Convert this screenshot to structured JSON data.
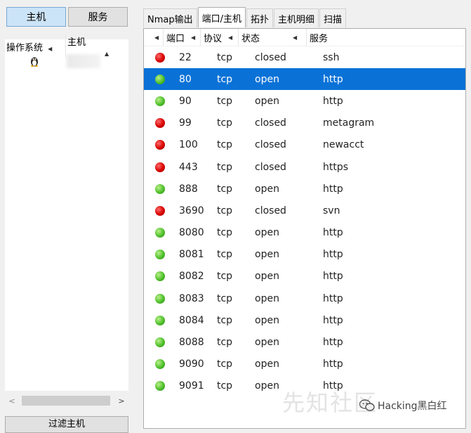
{
  "left_panel": {
    "hosts_button": "主机",
    "services_button": "服务",
    "columns": {
      "os": "操作系统",
      "host": "主机"
    },
    "filter_button": "过滤主机"
  },
  "tabs": [
    "Nmap输出",
    "端口/主机",
    "拓扑",
    "主机明细",
    "扫描"
  ],
  "active_tab": "端口/主机",
  "ports_table": {
    "columns": {
      "port": "端口",
      "protocol": "协议",
      "state": "状态",
      "service": "服务"
    },
    "selected_row": 1,
    "rows": [
      {
        "status": "red",
        "port": "22",
        "protocol": "tcp",
        "state": "closed",
        "service": "ssh"
      },
      {
        "status": "green",
        "port": "80",
        "protocol": "tcp",
        "state": "open",
        "service": "http"
      },
      {
        "status": "green",
        "port": "90",
        "protocol": "tcp",
        "state": "open",
        "service": "http"
      },
      {
        "status": "red",
        "port": "99",
        "protocol": "tcp",
        "state": "closed",
        "service": "metagram"
      },
      {
        "status": "red",
        "port": "100",
        "protocol": "tcp",
        "state": "closed",
        "service": "newacct"
      },
      {
        "status": "red",
        "port": "443",
        "protocol": "tcp",
        "state": "closed",
        "service": "https"
      },
      {
        "status": "green",
        "port": "888",
        "protocol": "tcp",
        "state": "open",
        "service": "http"
      },
      {
        "status": "red",
        "port": "3690",
        "protocol": "tcp",
        "state": "closed",
        "service": "svn"
      },
      {
        "status": "green",
        "port": "8080",
        "protocol": "tcp",
        "state": "open",
        "service": "http"
      },
      {
        "status": "green",
        "port": "8081",
        "protocol": "tcp",
        "state": "open",
        "service": "http"
      },
      {
        "status": "green",
        "port": "8082",
        "protocol": "tcp",
        "state": "open",
        "service": "http"
      },
      {
        "status": "green",
        "port": "8083",
        "protocol": "tcp",
        "state": "open",
        "service": "http"
      },
      {
        "status": "green",
        "port": "8084",
        "protocol": "tcp",
        "state": "open",
        "service": "http"
      },
      {
        "status": "green",
        "port": "8088",
        "protocol": "tcp",
        "state": "open",
        "service": "http"
      },
      {
        "status": "green",
        "port": "9090",
        "protocol": "tcp",
        "state": "open",
        "service": "http"
      },
      {
        "status": "green",
        "port": "9091",
        "protocol": "tcp",
        "state": "open",
        "service": "http"
      }
    ]
  },
  "watermark": "先知社区",
  "brand": "Hacking黑白红",
  "colors": {
    "selection": "#0a72d7",
    "open": "#4fbf2b",
    "closed": "#d80000"
  }
}
